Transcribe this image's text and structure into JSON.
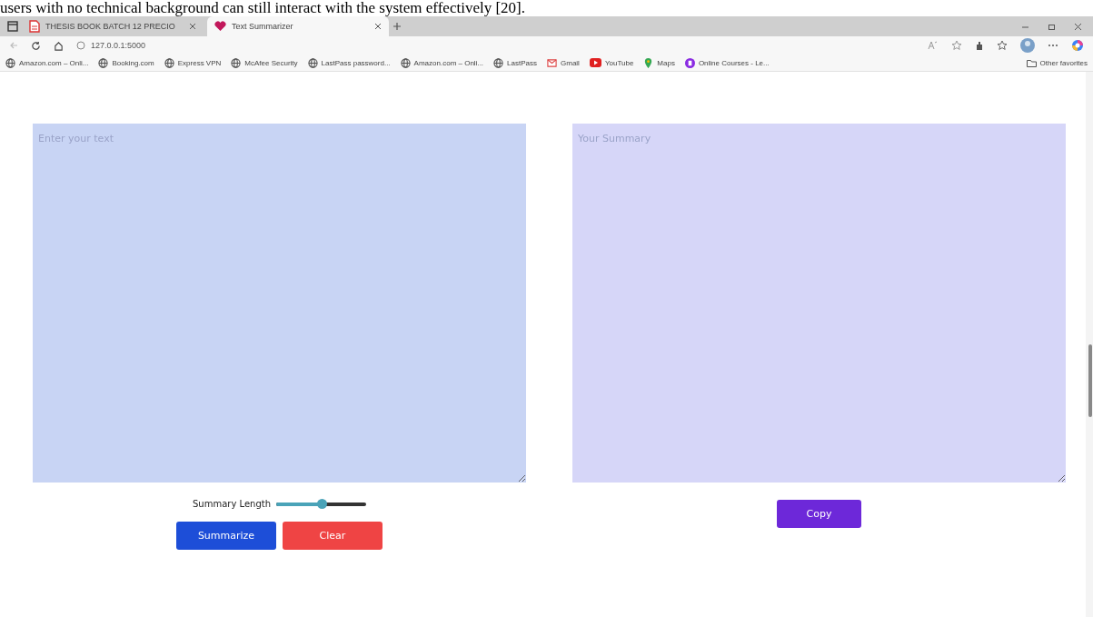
{
  "document_line": "users with no technical background can still interact with the system effectively [20].",
  "browser": {
    "tabs": [
      {
        "title": "THESIS BOOK BATCH 12 PRECIO",
        "selected": false,
        "kind": "pdf"
      },
      {
        "title": "Text Summarizer",
        "selected": true,
        "kind": "heart"
      }
    ],
    "address": "127.0.0.1:5000",
    "bookmarks": [
      {
        "label": "Amazon.com – Onli...",
        "kind": "globe"
      },
      {
        "label": "Booking.com",
        "kind": "globe"
      },
      {
        "label": "Express VPN",
        "kind": "globe"
      },
      {
        "label": "McAfee Security",
        "kind": "globe"
      },
      {
        "label": "LastPass password...",
        "kind": "globe"
      },
      {
        "label": "Amazon.com – Onli...",
        "kind": "globe"
      },
      {
        "label": "LastPass",
        "kind": "globe"
      },
      {
        "label": "Gmail",
        "kind": "mail"
      },
      {
        "label": "YouTube",
        "kind": "video"
      },
      {
        "label": "Maps",
        "kind": "map"
      },
      {
        "label": "Online Courses - Le...",
        "kind": "course"
      }
    ],
    "other_favorites": "Other favorites"
  },
  "input": {
    "placeholder": "Enter your text"
  },
  "slider": {
    "label": "Summary Length",
    "level": 0.5
  },
  "buttons": [
    {
      "label": "Summarize",
      "kind": "primary"
    },
    {
      "label": "Clear",
      "kind": "danger"
    }
  ],
  "output": {
    "placeholder": "Your Summary"
  },
  "copy_button": {
    "label": "Copy"
  }
}
